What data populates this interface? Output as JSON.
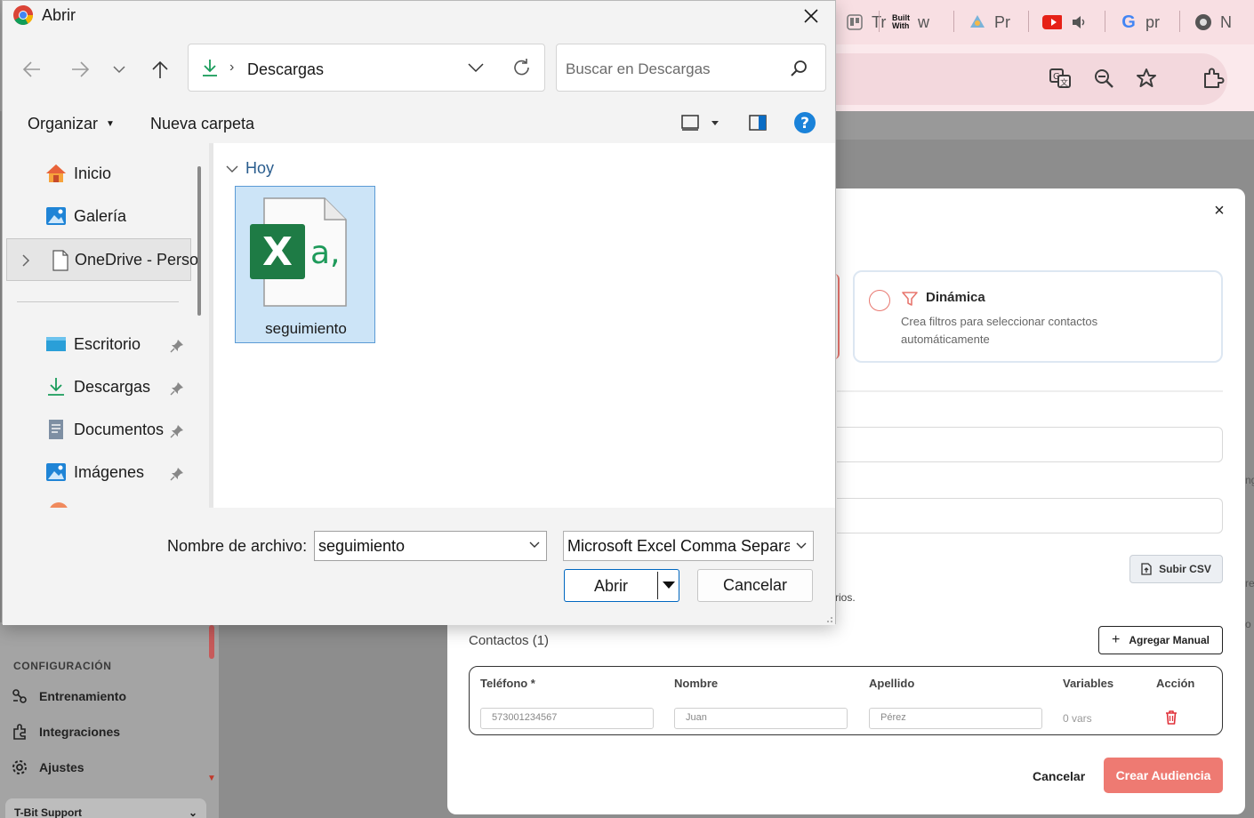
{
  "browser": {
    "tabs": [
      {
        "label": "Tr",
        "icon": "trello-icon"
      },
      {
        "label": "w",
        "icon": "builtwith-icon"
      },
      {
        "label": "Pr",
        "icon": "app-icon"
      },
      {
        "label": "",
        "icon": "youtube-icon"
      },
      {
        "label": "pr",
        "icon": "google-icon"
      },
      {
        "label": "N",
        "icon": "chrome-icon"
      }
    ]
  },
  "app": {
    "sidebar": {
      "section": "CONFIGURACIÓN",
      "items": [
        {
          "label": "Entrenamiento",
          "icon": "training-icon"
        },
        {
          "label": "Integraciones",
          "icon": "integrations-icon"
        },
        {
          "label": "Ajustes",
          "icon": "settings-icon"
        }
      ],
      "footer": "T-Bit Support"
    },
    "modal": {
      "option": {
        "title": "Dinámica",
        "description": "Crea filtros para seleccionar contactos automáticamente"
      },
      "upload_csv": "Subir CSV",
      "helper_tail": "rios.",
      "contacts_label": "Contactos (1)",
      "add_manual": "Agregar Manual",
      "table": {
        "headers": [
          "Teléfono *",
          "Nombre",
          "Apellido",
          "Variables",
          "Acción"
        ],
        "row": {
          "phone": "573001234567",
          "name": "Juan",
          "last": "Pérez",
          "vars": "0 vars"
        }
      },
      "cancel": "Cancelar",
      "create": "Crear Audiencia",
      "right_edge": [
        "ng",
        "rev",
        "o"
      ]
    }
  },
  "dialog": {
    "title": "Abrir",
    "path": "Descargas",
    "search_placeholder": "Buscar en Descargas",
    "commands": {
      "organize": "Organizar",
      "new_folder": "Nueva carpeta"
    },
    "nav": [
      {
        "label": "Inicio",
        "icon": "home-icon"
      },
      {
        "label": "Galería",
        "icon": "gallery-icon"
      },
      {
        "label": "OneDrive - Perso",
        "icon": "onedrive-icon"
      },
      {
        "label": "Escritorio",
        "icon": "desktop-icon"
      },
      {
        "label": "Descargas",
        "icon": "downloads-icon"
      },
      {
        "label": "Documentos",
        "icon": "documents-icon"
      },
      {
        "label": "Imágenes",
        "icon": "pictures-icon"
      }
    ],
    "group": "Hoy",
    "file": {
      "name": "seguimiento",
      "icon": "excel-csv-icon"
    },
    "filename_label": "Nombre de archivo:",
    "filename_value": "seguimiento",
    "filetype": "Microsoft Excel Comma Separat",
    "open": "Abrir",
    "cancel": "Cancelar"
  }
}
